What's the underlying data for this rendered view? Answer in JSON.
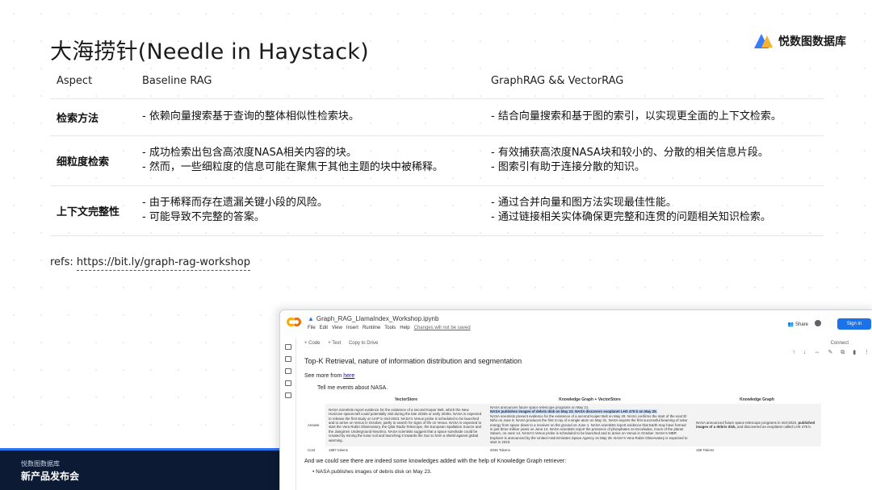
{
  "slide": {
    "title": "大海捞针(Needle in Haystack)",
    "logo_text": "悦数图数据库",
    "refs_label": "refs: ",
    "refs_url": "https://bit.ly/graph-rag-workshop",
    "footer_line1": "悦数图数据库",
    "footer_line2": "新产品发布会"
  },
  "table": {
    "headers": [
      "Aspect",
      "Baseline RAG",
      "GraphRAG && VectorRAG"
    ],
    "rows": [
      {
        "aspect": "检索方法",
        "baseline": [
          "- 依赖向量搜索基于查询的整体相似性检索块。"
        ],
        "graph": [
          "- 结合向量搜索和基于图的索引，以实现更全面的上下文检索。"
        ]
      },
      {
        "aspect": "细粒度检索",
        "baseline": [
          "- 成功检索出包含高浓度NASA相关内容的块。",
          "- 然而，一些细粒度的信息可能在聚焦于其他主题的块中被稀释。"
        ],
        "graph": [
          "- 有效捕获高浓度NASA块和较小的、分散的相关信息片段。",
          "- 图索引有助于连接分散的知识。"
        ]
      },
      {
        "aspect": "上下文完整性",
        "baseline": [
          "- 由于稀释而存在遗漏关键小段的风险。",
          "- 可能导致不完整的答案。"
        ],
        "graph": [
          "- 通过合并向量和图方法实现最佳性能。",
          "- 通过链接相关实体确保更完整和连贯的问题相关知识检索。"
        ]
      }
    ]
  },
  "colab": {
    "notebook_title": "Graph_RAG_LlamaIndex_Workshop.ipynb",
    "menu": [
      "File",
      "Edit",
      "View",
      "Insert",
      "Runtime",
      "Tools",
      "Help"
    ],
    "unsaved": "Changes will not be saved",
    "share": "Share",
    "sign_in": "Sign in",
    "toolbar": [
      "+ Code",
      "+ Text",
      "Copy to Drive"
    ],
    "connect": "Connect",
    "cell_tools": "↑ ↓ ⇔ ✎ ⧉ ▮ ⋮",
    "heading": "Top-K Retrieval, nature of information distribution and segmentation",
    "see_more_prefix": "See more from ",
    "see_more_link": "here",
    "prompt": "Tell me events about NASA.",
    "mini_table": {
      "headers": [
        "",
        "VectorStore",
        "Knowledge Graph + VectorStore",
        "Knowledge Graph"
      ],
      "answer_label": "Answer",
      "cost_label": "Cost",
      "vector_answer": "NASA scientists report evidence for the existence of a second Kuiper Belt, which the New Horizons spacecraft could potentially visit during the late 2020s or early 2030s. NASA is expected to release the first study on UAP in mid-2023. NASA's Venus probe is scheduled to be launched and to arrive on Venus in October, partly to search for signs of life on Venus. NASA is expected to start the Vera Rubin Observatory, the Qitai Radio Telescope, the European Spallation Source and the Jiangmen Underground Neutrino. NASA scientists suggest that a space sunshade could be created by mining the lunar soil and launching it towards the Sun to form a shield against global warming.",
      "kg_vector_answer_pre": "NASA announces future space telescope programs on May 21.",
      "kg_vector_answer_hl": "NASA publishes images of debris disk on May 23. NASA discovers exoplanet LHS 475 b on May 25.",
      "kg_vector_answer_post": "NASA scientists present evidence for the existence of a second Kuiper Belt on May 29. NASA confirms the start of the next El Niño on June 8. NASA produces the first X-ray of a single atom on May 31. NASA reports the first successful beaming of solar energy from space down to a receiver on the ground on June 1. NASA scientists report evidence that Earth may have formed in just three million years on June 14. NASA scientists report the presence of phosphates on Enceladus, moon of the planet Saturn, on June 14. NASA's Venus probe is scheduled to be launched and to arrive on Venus in October. NASA's MBR Explorer is announced by the United Arab Emirates Space Agency on May 29. NASA's Vera Rubin Observatory is expected to start in 2023.",
      "kg_answer_pre": "NASA announced future space telescope programs in mid-2023,",
      "kg_answer_bold": "published images of a debris disk,",
      "kg_answer_post": "and discovered an exoplanet called LHS 475 b.",
      "cost_vector": "1897 tokens",
      "cost_kg_vector": "2046 Tokens",
      "cost_kg": "159 Tokens"
    },
    "tail_text": "And we could see there are indeed some knowledges added with the help of Knowledge Graph retriever:",
    "bullet_text": "NASA publishes images of debris disk on May 23."
  }
}
